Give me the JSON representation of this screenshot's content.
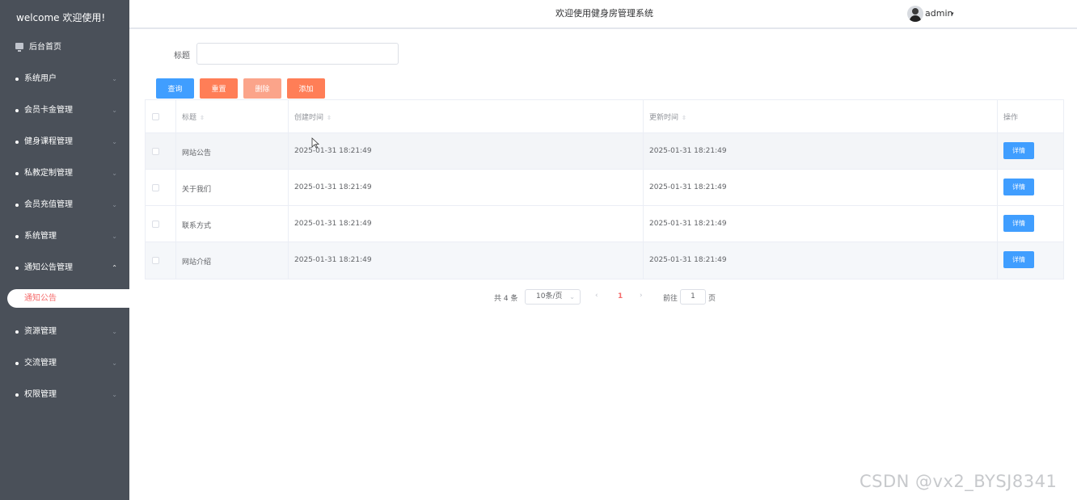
{
  "sidebar": {
    "brand": "welcome 欢迎使用!",
    "home": "后台首页",
    "items": [
      {
        "label": "系统用户"
      },
      {
        "label": "会员卡金管理"
      },
      {
        "label": "健身课程管理"
      },
      {
        "label": "私教定制管理"
      },
      {
        "label": "会员充值管理"
      },
      {
        "label": "系统管理"
      },
      {
        "label": "通知公告管理"
      },
      {
        "label": "资源管理"
      },
      {
        "label": "交流管理"
      },
      {
        "label": "权限管理"
      }
    ],
    "active_sub": "通知公告",
    "chevron_down": "⌄",
    "chevron_up": "⌃"
  },
  "header": {
    "title": "欢迎使用健身房管理系统",
    "user": "admin",
    "caret": "▾"
  },
  "search": {
    "label": "标题",
    "value": "",
    "placeholder": ""
  },
  "toolbar": {
    "query": "查询",
    "reset": "重置",
    "delete": "删除",
    "add": "添加"
  },
  "table": {
    "columns": {
      "title": "标题",
      "created": "创建时间",
      "updated": "更新时间",
      "action": "操作"
    },
    "sort_glyph": "⇳",
    "rows": [
      {
        "title": "网站公告",
        "created": "2025-01-31 18:21:49",
        "updated": "2025-01-31 18:21:49",
        "action": "详情"
      },
      {
        "title": "关于我们",
        "created": "2025-01-31 18:21:49",
        "updated": "2025-01-31 18:21:49",
        "action": "详情"
      },
      {
        "title": "联系方式",
        "created": "2025-01-31 18:21:49",
        "updated": "2025-01-31 18:21:49",
        "action": "详情"
      },
      {
        "title": "网站介绍",
        "created": "2025-01-31 18:21:49",
        "updated": "2025-01-31 18:21:49",
        "action": "详情"
      }
    ]
  },
  "pagination": {
    "total": "共 4 条",
    "page_size": "10条/页",
    "prev": "‹",
    "current": "1",
    "next": "›",
    "goto": "前往",
    "goto_value": "1",
    "page_unit": "页"
  },
  "watermark": "CSDN @vx2_BYSJ8341",
  "colors": {
    "sidebar_bg": "#4a5059",
    "primary": "#409eff",
    "warning": "#ff7e57",
    "danger_light": "#fba48a",
    "active_text": "#f56c6c"
  }
}
